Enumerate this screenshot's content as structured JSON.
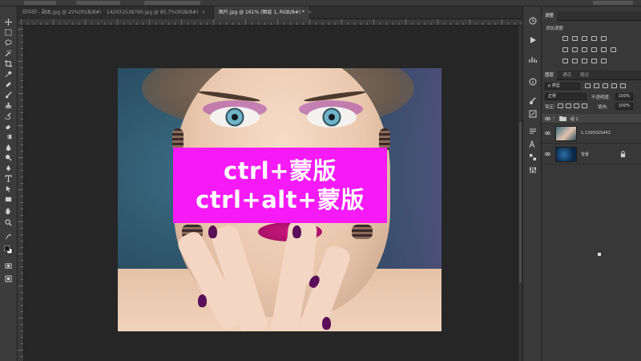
{
  "document_tabs": [
    {
      "label": "印中印 - 副本.jpg @ 25%(RGB/8#)",
      "close": "×",
      "active": false
    },
    {
      "label": "142031538760.jpg @ 85.7%(RGB/8#)",
      "close": "×",
      "active": false
    },
    {
      "label": "图片.jpg @ 161% (图层 1, RGB/8#) *",
      "close": "×",
      "active": true
    }
  ],
  "tools": [
    "move-tool",
    "marquee-tool",
    "lasso-tool",
    "magic-wand-tool",
    "crop-tool",
    "eyedropper-tool",
    "healing-brush-tool",
    "brush-tool",
    "clone-stamp-tool",
    "history-brush-tool",
    "eraser-tool",
    "gradient-tool",
    "blur-tool",
    "dodge-tool",
    "pen-tool",
    "type-tool",
    "path-selection-tool",
    "rectangle-tool",
    "hand-tool",
    "zoom-tool",
    "swap-colors-tool",
    "color-swatches",
    "quick-mask-tool",
    "screen-mode-tool"
  ],
  "overlay": {
    "line1": "ctrl+蒙版",
    "line2": "ctrl+alt+蒙版",
    "color": "#f51af6"
  },
  "panels": {
    "top_tabs": [
      "调整"
    ],
    "adjustments_label": "添加调整",
    "layer_tabs": [
      "图层",
      "通道",
      "路径"
    ],
    "kind_filter": "ρ 类型",
    "blend_mode": "正常",
    "opacity_label": "不透明度:",
    "opacity_value": "100%",
    "lock_label": "锁定:",
    "fill_label": "填充:",
    "fill_value": "100%",
    "layers": [
      {
        "name": "组 1",
        "type": "group"
      },
      {
        "name": "1-130502S443",
        "type": "image"
      },
      {
        "name": "背景",
        "type": "background"
      }
    ]
  }
}
